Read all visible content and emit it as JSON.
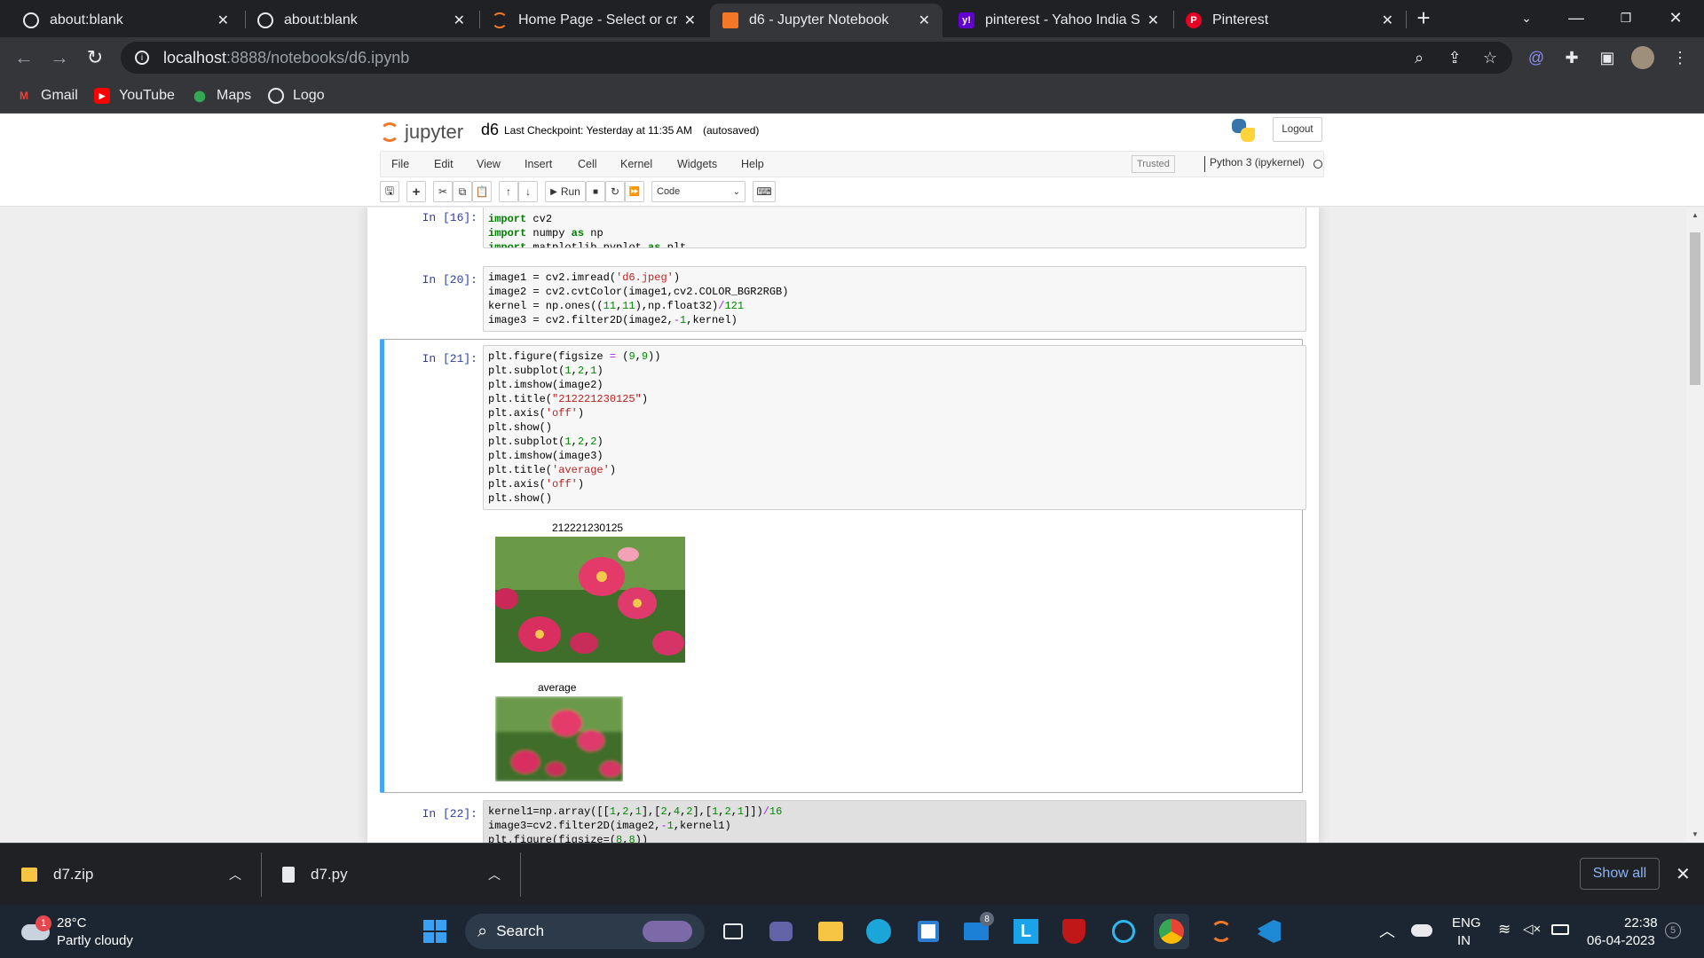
{
  "browser": {
    "tabs": [
      {
        "title": "about:blank",
        "icon": "globe-icon",
        "active": false
      },
      {
        "title": "about:blank",
        "icon": "globe-icon",
        "active": false
      },
      {
        "title": "Home Page - Select or crea",
        "icon": "jupyter-icon",
        "active": false
      },
      {
        "title": "d6 - Jupyter Notebook",
        "icon": "notebook-icon",
        "active": true
      },
      {
        "title": "pinterest - Yahoo India Sea",
        "icon": "yahoo-icon",
        "active": false
      },
      {
        "title": "Pinterest",
        "icon": "pinterest-icon",
        "active": false
      }
    ],
    "url_host": "localhost",
    "url_path": ":8888/notebooks/d6.ipynb",
    "bookmarks": [
      {
        "label": "Gmail",
        "icon": "gmail-icon"
      },
      {
        "label": "YouTube",
        "icon": "youtube-icon"
      },
      {
        "label": "Maps",
        "icon": "maps-icon"
      },
      {
        "label": "Logo",
        "icon": "globe-icon"
      }
    ]
  },
  "jupyter": {
    "logo_text": "jupyter",
    "notebook_name": "d6",
    "checkpoint": "Last Checkpoint: Yesterday at 11:35 AM",
    "autosaved": "(autosaved)",
    "logout": "Logout",
    "menu": [
      "File",
      "Edit",
      "View",
      "Insert",
      "Cell",
      "Kernel",
      "Widgets",
      "Help"
    ],
    "trusted": "Trusted",
    "kernel": "Python 3 (ipykernel)",
    "run_label": "Run",
    "cell_type": "Code"
  },
  "cells": [
    {
      "prompt": "In [16]:"
    },
    {
      "prompt": "In [20]:"
    },
    {
      "prompt": "In [21]:",
      "output_titles": [
        "212221230125",
        "average"
      ]
    },
    {
      "prompt": "In [22]:"
    }
  ],
  "downloads": [
    {
      "name": "d7.zip",
      "icon": "zip-file-icon"
    },
    {
      "name": "d7.py",
      "icon": "py-file-icon"
    }
  ],
  "downloads_show_all": "Show all",
  "taskbar": {
    "weather_temp": "28°C",
    "weather_desc": "Partly cloudy",
    "weather_badge": "1",
    "search": "Search",
    "lang_line1": "ENG",
    "lang_line2": "IN",
    "time": "22:38",
    "date": "06-04-2023",
    "notif_count": "5",
    "mail_badge": "8"
  }
}
